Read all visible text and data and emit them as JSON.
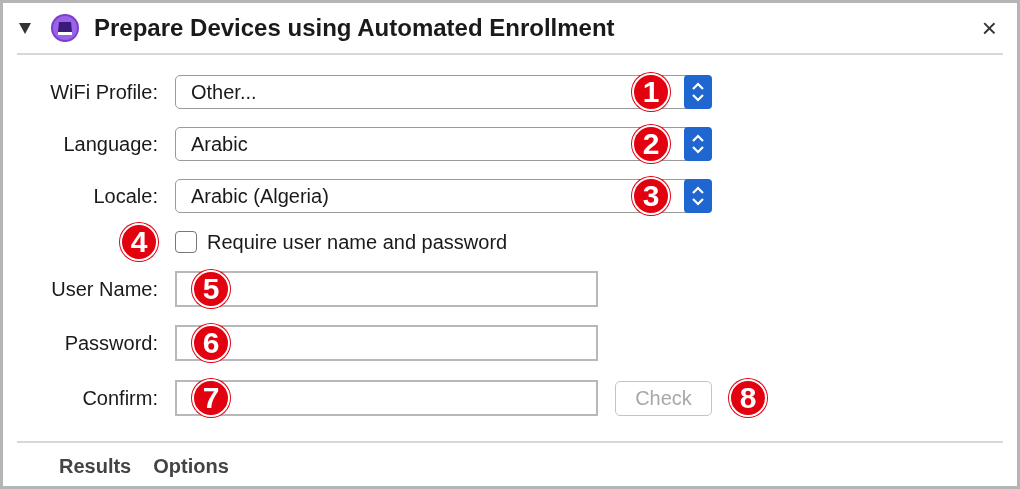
{
  "header": {
    "title": "Prepare Devices using Automated Enrollment",
    "expanded": true,
    "close": "×"
  },
  "popups": [
    {
      "label": "WiFi Profile:",
      "value": "Other...",
      "badge": "1"
    },
    {
      "label": "Language:",
      "value": "Arabic",
      "badge": "2"
    },
    {
      "label": "Locale:",
      "value": "Arabic (Algeria)",
      "badge": "3"
    }
  ],
  "checkbox": {
    "label": "Require user name and password",
    "checked": false,
    "badge": "4"
  },
  "fields": [
    {
      "label": "User Name:",
      "badge": "5"
    },
    {
      "label": "Password:",
      "badge": "6"
    },
    {
      "label": "Confirm:",
      "badge": "7"
    }
  ],
  "check_button": {
    "label": "Check",
    "disabled": true,
    "badge": "8"
  },
  "tabs": [
    {
      "label": "Results"
    },
    {
      "label": "Options"
    }
  ]
}
